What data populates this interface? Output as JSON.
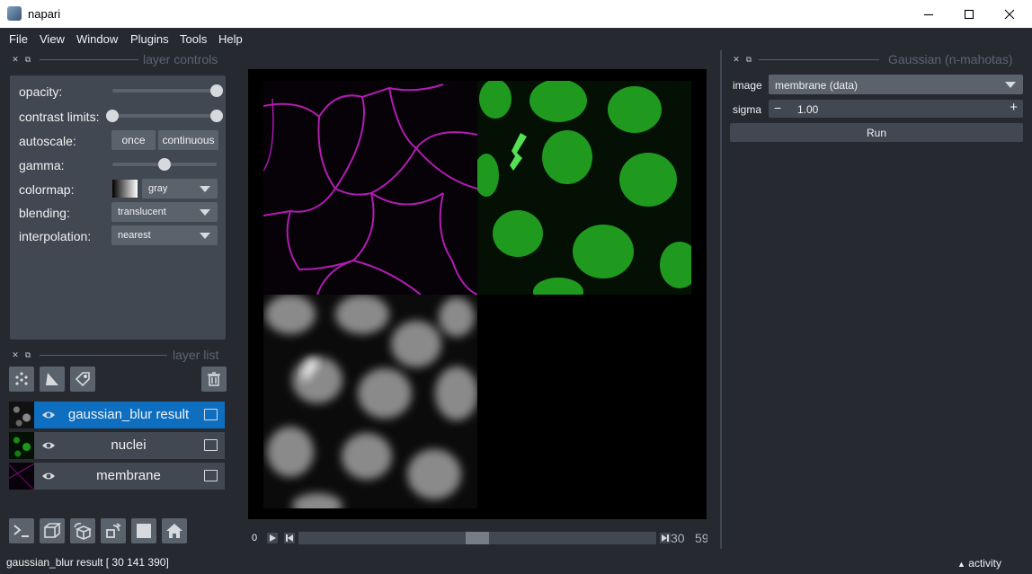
{
  "window": {
    "title": "napari"
  },
  "menu": [
    "File",
    "View",
    "Window",
    "Plugins",
    "Tools",
    "Help"
  ],
  "layer_controls": {
    "header": "layer controls",
    "opacity_label": "opacity:",
    "contrast_label": "contrast limits:",
    "autoscale_label": "autoscale:",
    "autoscale_once": "once",
    "autoscale_continuous": "continuous",
    "gamma_label": "gamma:",
    "colormap_label": "colormap:",
    "colormap_value": "gray",
    "blending_label": "blending:",
    "blending_value": "translucent",
    "interpolation_label": "interpolation:",
    "interpolation_value": "nearest",
    "opacity_value": 1.0,
    "contrast_range": [
      0.0,
      1.0
    ],
    "gamma_value": 0.5
  },
  "layer_list": {
    "header": "layer list",
    "layers": [
      {
        "name": "gaussian_blur result",
        "selected": true,
        "visible": true,
        "type_icon": "image-icon"
      },
      {
        "name": "nuclei",
        "selected": false,
        "visible": true,
        "type_icon": "image-icon"
      },
      {
        "name": "membrane",
        "selected": false,
        "visible": true,
        "type_icon": "image-icon"
      }
    ]
  },
  "dims": {
    "current": "0",
    "tail_labels": [
      "30",
      "59"
    ],
    "slider_position": 0.5
  },
  "plugin_panel": {
    "header": "Gaussian (n-mahotas)",
    "image_label": "image",
    "image_value": "membrane (data)",
    "sigma_label": "sigma",
    "sigma_minus": "−",
    "sigma_value": "1.00",
    "sigma_plus": "+",
    "run_label": "Run"
  },
  "status": {
    "text": "gaussian_blur result [ 30 141 390]",
    "activity_label": "activity"
  },
  "colors": {
    "background": "#262930",
    "panel": "#414851",
    "control": "#5a626c",
    "selection": "#0e6fc0",
    "membrane": "#c020c0",
    "nuclei": "#20c020"
  }
}
